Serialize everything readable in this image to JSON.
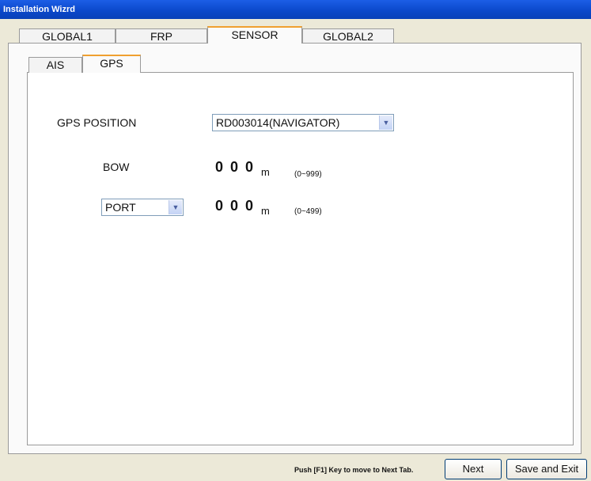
{
  "window": {
    "title": "Installation Wizrd"
  },
  "main_tabs": [
    {
      "label": "GLOBAL1",
      "active": false
    },
    {
      "label": "FRP",
      "active": false
    },
    {
      "label": "SENSOR",
      "active": true
    },
    {
      "label": "GLOBAL2",
      "active": false
    }
  ],
  "sub_tabs": [
    {
      "label": "AIS",
      "active": false
    },
    {
      "label": "GPS",
      "active": true
    }
  ],
  "gps": {
    "position_label": "GPS POSITION",
    "position_value": "RD003014(NAVIGATOR)",
    "bow_label": "BOW",
    "bow_value": "0 0 0",
    "bow_unit": "m",
    "bow_range": "(0~999)",
    "side_value": "PORT",
    "side_distance": "0 0 0",
    "side_unit": "m",
    "side_range": "(0~499)"
  },
  "footer": {
    "hint": "Push [F1] Key to move to Next Tab.",
    "next_label": "Next",
    "save_label": "Save and Exit"
  },
  "colors": {
    "titlebar": "#0a47c9",
    "active_tab_accent": "#f0a030",
    "background": "#ece9d8"
  }
}
